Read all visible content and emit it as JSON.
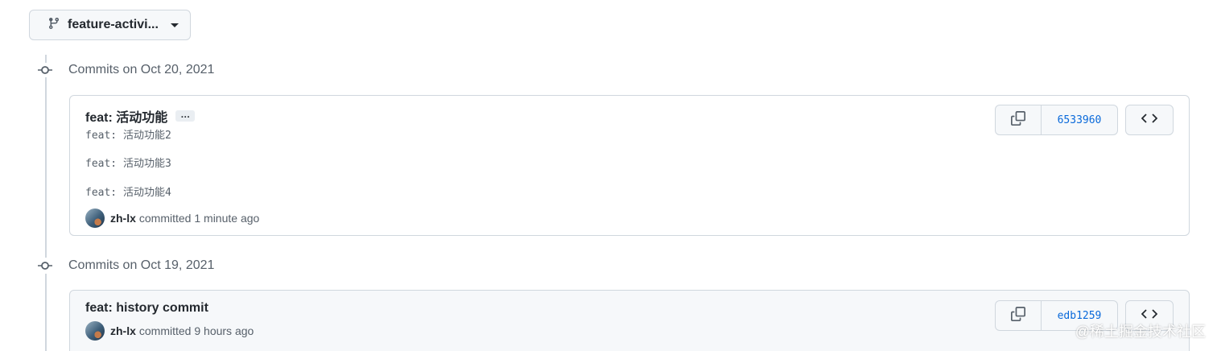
{
  "branch": {
    "name": "feature-activi..."
  },
  "groups": [
    {
      "heading": "Commits on Oct 20, 2021",
      "commit": {
        "title": "feat: 活动功能",
        "ellipsis": "…",
        "description": [
          "feat: 活动功能2",
          "feat: 活动功能3",
          "feat: 活动功能4"
        ],
        "author": "zh-lx",
        "committed_text": "committed 1 minute ago",
        "sha": "6533960"
      }
    },
    {
      "heading": "Commits on Oct 19, 2021",
      "commit": {
        "title": "feat: history commit",
        "author": "zh-lx",
        "committed_text": "committed 9 hours ago",
        "sha": "edb1259"
      }
    }
  ],
  "watermark": "@稀土掘金技术社区",
  "icons": {
    "branch": "git-branch-icon",
    "commit": "git-commit-icon",
    "copy": "copy-icon",
    "browse": "code-icon",
    "caret": "caret-down-icon"
  },
  "colors": {
    "link": "#0969da",
    "muted": "#57606a",
    "border": "#d0d7de",
    "button_bg": "#f6f8fa"
  }
}
